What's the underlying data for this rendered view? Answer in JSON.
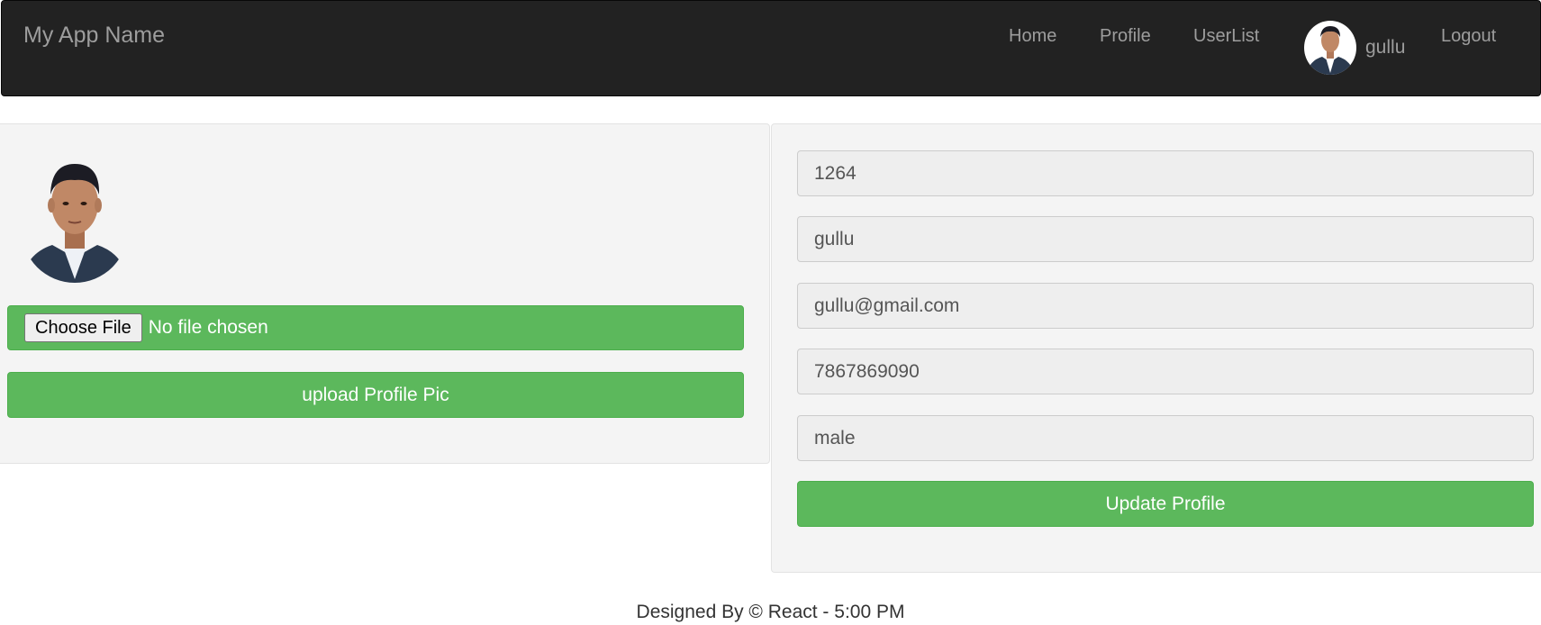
{
  "navbar": {
    "brand": "My App Name",
    "links": {
      "home": "Home",
      "profile": "Profile",
      "userlist": "UserList",
      "logout": "Logout"
    },
    "user_name": "gullu"
  },
  "upload": {
    "choose_file_label": "Choose File",
    "file_status": "No file chosen",
    "upload_button": "upload Profile Pic"
  },
  "profile_form": {
    "id": "1264",
    "name": "gullu",
    "email": "gullu@gmail.com",
    "phone": "7867869090",
    "gender": "male",
    "update_button": "Update Profile"
  },
  "footer": {
    "text": "Designed By © React - 5:00 PM"
  },
  "colors": {
    "navbar_bg": "#222222",
    "nav_text": "#9d9d9d",
    "success_green": "#5cb85c",
    "panel_bg": "#f4f4f4"
  }
}
